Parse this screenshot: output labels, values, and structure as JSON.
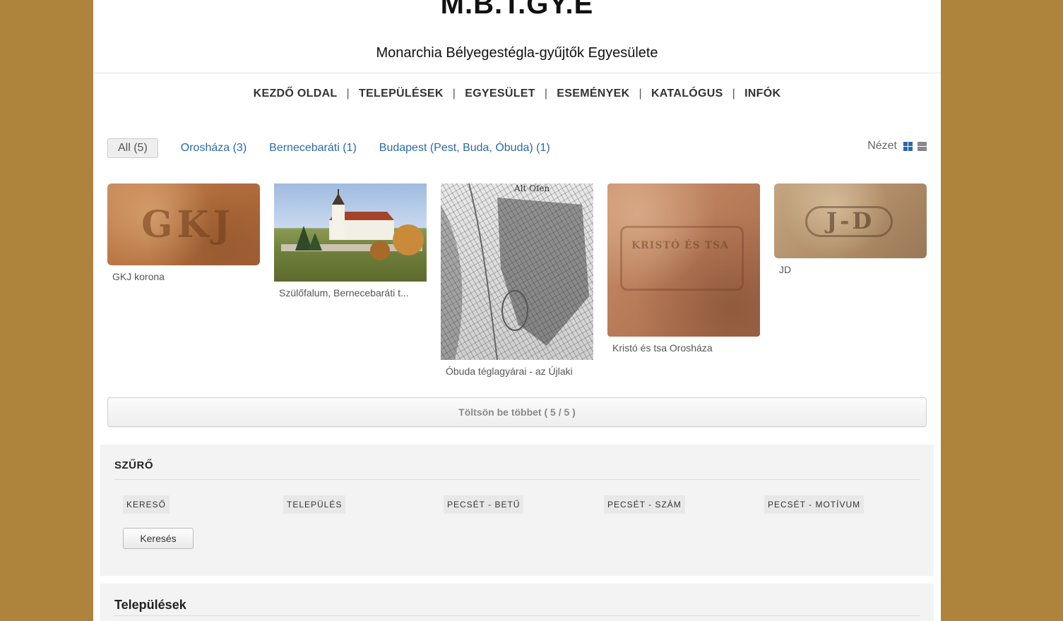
{
  "header": {
    "title": "M.B.T.GY.E",
    "subtitle": "Monarchia Bélyegestégla-gyűjtők Egyesülete"
  },
  "nav": {
    "items": [
      "KEZDŐ OLDAL",
      "TELEPÜLÉSEK",
      "EGYESÜLET",
      "ESEMÉNYEK",
      "KATALÓGUS",
      "INFÓK"
    ],
    "separator": "|"
  },
  "filters": {
    "all": "All (5)",
    "tags": [
      "Orosháza (3)",
      "Bernecebaráti (1)",
      "Budapest (Pest, Buda, Óbuda) (1)"
    ]
  },
  "view": {
    "label": "Nézet",
    "grid_icon": "grid-view-icon",
    "list_icon": "list-view-icon"
  },
  "gallery": {
    "items": [
      {
        "caption": "GKJ korona",
        "stamp": "GKJ"
      },
      {
        "caption": "Szülőfalum, Bernecebaráti t..."
      },
      {
        "caption": "Óbuda téglagyárai - az Újlaki",
        "map_label": "Alt Ofen"
      },
      {
        "caption": "Kristó és tsa Orosháza",
        "stamp": "KRISTÓ ÉS TSA"
      },
      {
        "caption": "JD",
        "stamp": "J-D"
      }
    ]
  },
  "load_more": {
    "label": "Töltsön be többet ( 5 / 5 )"
  },
  "filter_panel": {
    "title": "SZŰRŐ",
    "fields": [
      "KERESŐ",
      "TELEPÜLÉS",
      "PECSÉT - BETŰ",
      "PECSÉT - SZÁM",
      "PECSÉT - MOTÍVUM"
    ],
    "search_button": "Keresés"
  },
  "settlements_panel": {
    "title": "Települések"
  },
  "colors": {
    "background": "#ae843d",
    "link": "#2a6aa8",
    "panel": "#f3f3f3"
  }
}
